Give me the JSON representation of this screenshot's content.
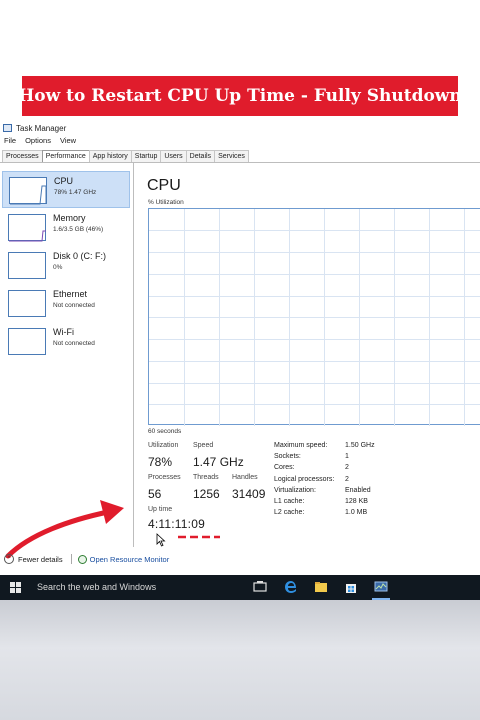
{
  "banner": {
    "text": "How to Restart CPU Up Time - Fully Shutdown",
    "color": "#e01c2c"
  },
  "window": {
    "title": "Task Manager"
  },
  "menu": [
    "File",
    "Options",
    "View"
  ],
  "tabs": [
    "Processes",
    "Performance",
    "App history",
    "Startup",
    "Users",
    "Details",
    "Services"
  ],
  "active_tab": "Performance",
  "resources": [
    {
      "name": "CPU",
      "sub": "78% 1.47 GHz",
      "active": true
    },
    {
      "name": "Memory",
      "sub": "1.6/3.5 GB (46%)"
    },
    {
      "name": "Disk 0 (C: F:)",
      "sub": "0%"
    },
    {
      "name": "Ethernet",
      "sub": "Not connected"
    },
    {
      "name": "Wi-Fi",
      "sub": "Not connected"
    }
  ],
  "main": {
    "title": "CPU",
    "util_label": "% Utilization",
    "time_label": "60 seconds"
  },
  "stats": {
    "utilization_label": "Utilization",
    "utilization": "78%",
    "speed_label": "Speed",
    "speed": "1.47 GHz",
    "processes_label": "Processes",
    "processes": "56",
    "threads_label": "Threads",
    "threads": "1256",
    "handles_label": "Handles",
    "handles": "31409",
    "uptime_label": "Up time",
    "uptime": "4:11:11:09"
  },
  "specs": [
    {
      "label": "Maximum speed:",
      "value": "1.50 GHz"
    },
    {
      "label": "Sockets:",
      "value": "1"
    },
    {
      "label": "Cores:",
      "value": "2"
    },
    {
      "label": "Logical processors:",
      "value": "2"
    },
    {
      "label": "Virtualization:",
      "value": "Enabled"
    },
    {
      "label": "L1 cache:",
      "value": "128 KB"
    },
    {
      "label": "L2 cache:",
      "value": "1.0 MB"
    }
  ],
  "footer": {
    "fewer": "Fewer details",
    "resmon": "Open Resource Monitor"
  },
  "taskbar": {
    "search": "Search the web and Windows"
  },
  "colors": {
    "graph_border": "#6f9bd0",
    "grid": "#d9e4f2",
    "selected": "#cde0f7",
    "arrow": "#e01c2c",
    "taskbar": "#101820"
  }
}
